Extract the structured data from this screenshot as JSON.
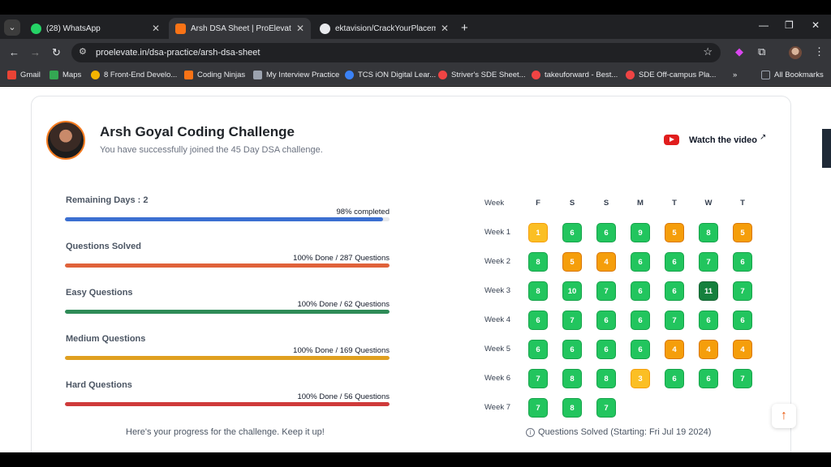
{
  "tabs": [
    {
      "title": "(28) WhatsApp",
      "active": false,
      "fav": "#25d366"
    },
    {
      "title": "Arsh DSA Sheet | ProElevate",
      "active": true,
      "fav": "#f97316"
    },
    {
      "title": "ektavision/CrackYourPlacement",
      "active": false,
      "fav": "#e8eaed"
    }
  ],
  "url": "proelevate.in/dsa-practice/arsh-dsa-sheet",
  "bookmarks": [
    {
      "label": "Gmail",
      "color": "#ea4335"
    },
    {
      "label": "Maps",
      "color": "#34a853"
    },
    {
      "label": "8 Front-End Develo...",
      "color": "#f4b400"
    },
    {
      "label": "Coding Ninjas",
      "color": "#f97316"
    },
    {
      "label": "My Interview Practice",
      "color": "#9ca3af"
    },
    {
      "label": "TCS iON Digital Lear...",
      "color": "#3b82f6"
    },
    {
      "label": "Striver's SDE Sheet...",
      "color": "#ef4444"
    },
    {
      "label": "takeuforward - Best...",
      "color": "#ef4444"
    },
    {
      "label": "SDE Off-campus Pla...",
      "color": "#ef4444"
    },
    {
      "label": "»",
      "color": ""
    },
    {
      "label": "All Bookmarks",
      "color": "#9ca3af"
    }
  ],
  "header": {
    "title": "Arsh Goyal Coding Challenge",
    "subtitle": "You have successfully joined the 45 Day DSA challenge.",
    "watch_label": "Watch the video"
  },
  "progress": [
    {
      "label": "Remaining Days : 2",
      "right": "98% completed",
      "percent": 98,
      "color": "#3b6fd1"
    },
    {
      "label": "Questions Solved",
      "right": "100% Done / 287 Questions",
      "percent": 100,
      "color": "#e0623a"
    },
    {
      "label": "Easy Questions",
      "right": "100% Done / 62 Questions",
      "percent": 100,
      "color": "#2e8b57"
    },
    {
      "label": "Medium Questions",
      "right": "100% Done / 169 Questions",
      "percent": 100,
      "color": "#e0a020"
    },
    {
      "label": "Hard Questions",
      "right": "100% Done / 56 Questions",
      "percent": 100,
      "color": "#cf3a3a"
    }
  ],
  "progress_footer": "Here's your progress for the challenge. Keep it up!",
  "calendar": {
    "week_header": "Week",
    "days": [
      "F",
      "S",
      "S",
      "M",
      "T",
      "W",
      "T"
    ],
    "weeks": [
      {
        "label": "Week 1",
        "cells": [
          {
            "v": "1",
            "c": "yellow"
          },
          {
            "v": "6",
            "c": "green"
          },
          {
            "v": "6",
            "c": "green"
          },
          {
            "v": "9",
            "c": "green"
          },
          {
            "v": "5",
            "c": "orange"
          },
          {
            "v": "8",
            "c": "green"
          },
          {
            "v": "5",
            "c": "orange"
          }
        ]
      },
      {
        "label": "Week 2",
        "cells": [
          {
            "v": "8",
            "c": "green"
          },
          {
            "v": "5",
            "c": "orange"
          },
          {
            "v": "4",
            "c": "orange"
          },
          {
            "v": "6",
            "c": "green"
          },
          {
            "v": "6",
            "c": "green"
          },
          {
            "v": "7",
            "c": "green"
          },
          {
            "v": "6",
            "c": "green"
          }
        ]
      },
      {
        "label": "Week 3",
        "cells": [
          {
            "v": "8",
            "c": "green"
          },
          {
            "v": "10",
            "c": "green"
          },
          {
            "v": "7",
            "c": "green"
          },
          {
            "v": "6",
            "c": "green"
          },
          {
            "v": "6",
            "c": "green"
          },
          {
            "v": "11",
            "c": "dark"
          },
          {
            "v": "7",
            "c": "green"
          }
        ]
      },
      {
        "label": "Week 4",
        "cells": [
          {
            "v": "6",
            "c": "green"
          },
          {
            "v": "7",
            "c": "green"
          },
          {
            "v": "6",
            "c": "green"
          },
          {
            "v": "6",
            "c": "green"
          },
          {
            "v": "7",
            "c": "green"
          },
          {
            "v": "6",
            "c": "green"
          },
          {
            "v": "6",
            "c": "green"
          }
        ]
      },
      {
        "label": "Week 5",
        "cells": [
          {
            "v": "6",
            "c": "green"
          },
          {
            "v": "6",
            "c": "green"
          },
          {
            "v": "6",
            "c": "green"
          },
          {
            "v": "6",
            "c": "green"
          },
          {
            "v": "4",
            "c": "orange"
          },
          {
            "v": "4",
            "c": "orange"
          },
          {
            "v": "4",
            "c": "orange"
          }
        ]
      },
      {
        "label": "Week 6",
        "cells": [
          {
            "v": "7",
            "c": "green"
          },
          {
            "v": "8",
            "c": "green"
          },
          {
            "v": "8",
            "c": "green"
          },
          {
            "v": "3",
            "c": "yellow"
          },
          {
            "v": "6",
            "c": "green"
          },
          {
            "v": "6",
            "c": "green"
          },
          {
            "v": "7",
            "c": "green"
          }
        ]
      },
      {
        "label": "Week 7",
        "cells": [
          {
            "v": "7",
            "c": "green"
          },
          {
            "v": "8",
            "c": "green"
          },
          {
            "v": "7",
            "c": "green"
          }
        ]
      }
    ],
    "footer": "Questions Solved (Starting: Fri Jul 19 2024)"
  }
}
